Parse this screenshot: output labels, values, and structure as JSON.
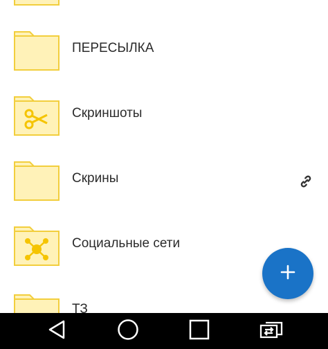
{
  "colors": {
    "folder_fill": "#FFF2B8",
    "folder_stroke": "#F2CE3C",
    "folder_icon": "#F5C400",
    "fab": "#1A73C7",
    "navbar": "#000000"
  },
  "folders": [
    {
      "label": "",
      "icon": "folder-icon",
      "partial": true
    },
    {
      "label": "ПЕРЕСЫЛКА",
      "icon": "folder-icon"
    },
    {
      "label": "Скриншоты",
      "icon": "scissors-folder-icon"
    },
    {
      "label": "Скрины",
      "icon": "folder-icon",
      "shared": true,
      "badge_icon": "link-icon"
    },
    {
      "label": "Социальные сети",
      "icon": "network-folder-icon"
    },
    {
      "label": "ТЗ",
      "icon": "folder-icon",
      "partial": true
    }
  ],
  "fab": {
    "icon": "plus-icon"
  },
  "navbar": {
    "buttons": [
      "back-icon",
      "home-icon",
      "recents-icon",
      "screen-switch-icon"
    ]
  }
}
